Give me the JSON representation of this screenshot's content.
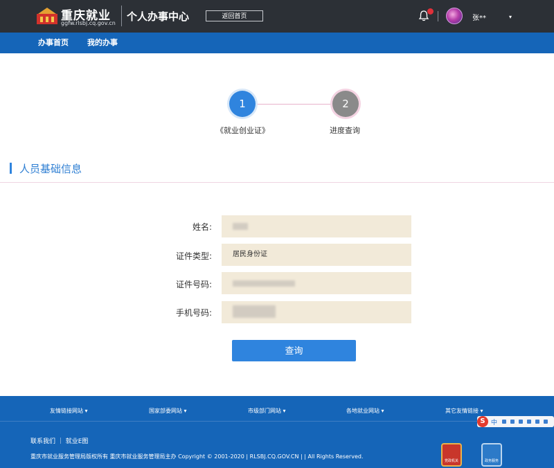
{
  "header": {
    "logo_title": "重庆就业",
    "logo_url": "ggfw.rlsbj.cq.gov.cn",
    "center_title": "个人办事中心",
    "back_home": "返回首页",
    "username": "张**",
    "caret": "▾"
  },
  "nav": {
    "items": [
      "办事首页",
      "我的办事"
    ]
  },
  "steps": [
    {
      "number": "1",
      "label": "《就业创业证》",
      "status": "active"
    },
    {
      "number": "2",
      "label": "进度查询",
      "status": "pending"
    }
  ],
  "section": {
    "title": "人员基础信息"
  },
  "form": {
    "name_label": "姓名:",
    "id_type_label": "证件类型:",
    "id_type_value": "居民身份证",
    "id_number_label": "证件号码:",
    "phone_label": "手机号码:",
    "submit_label": "查询"
  },
  "footer": {
    "links": [
      "友情链接网站 ▾",
      "国家部委网站 ▾",
      "市级部门网站 ▾",
      "各地就业网站 ▾",
      "其它友情链接 ▾"
    ],
    "contact": "联系我们 ｜ 就业E图",
    "copyright": "重庆市就业服务管理局版权所有    重庆市就业服务管理局主办    Copyright © 2001-2020 | RLSBJ.CQ.GOV.CN | | All Rights Reserved.",
    "badge1": "党政机关",
    "badge2": "政务服务"
  },
  "ime": {
    "logo": "S",
    "lang": "中"
  },
  "colors": {
    "header_bg": "#2c3036",
    "nav_bg": "#1565b8",
    "accent": "#2f84de",
    "input_bg": "#f2ead9"
  }
}
